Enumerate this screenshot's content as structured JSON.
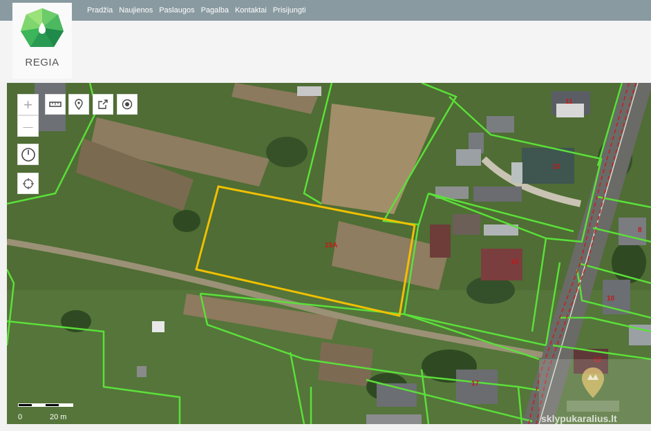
{
  "nav": {
    "items": [
      "Pradžia",
      "Naujienos",
      "Paslaugos",
      "Pagalba",
      "Kontaktai",
      "Prisijungti"
    ]
  },
  "logo": {
    "text": "REGIA"
  },
  "map": {
    "controls": {
      "zoom_in": "+",
      "zoom_out": "—"
    },
    "scale": {
      "start": "0",
      "end": "20 m"
    },
    "parcel_labels": [
      "11",
      "13",
      "15A",
      "15",
      "8",
      "10",
      "12",
      "17"
    ]
  },
  "watermark": {
    "text": "sklypukaralius.lt"
  },
  "colors": {
    "topbar": "#8a9aa1",
    "parcel_border": "#5be03a",
    "selected_parcel": "#f0c000",
    "label": "#c41818"
  }
}
